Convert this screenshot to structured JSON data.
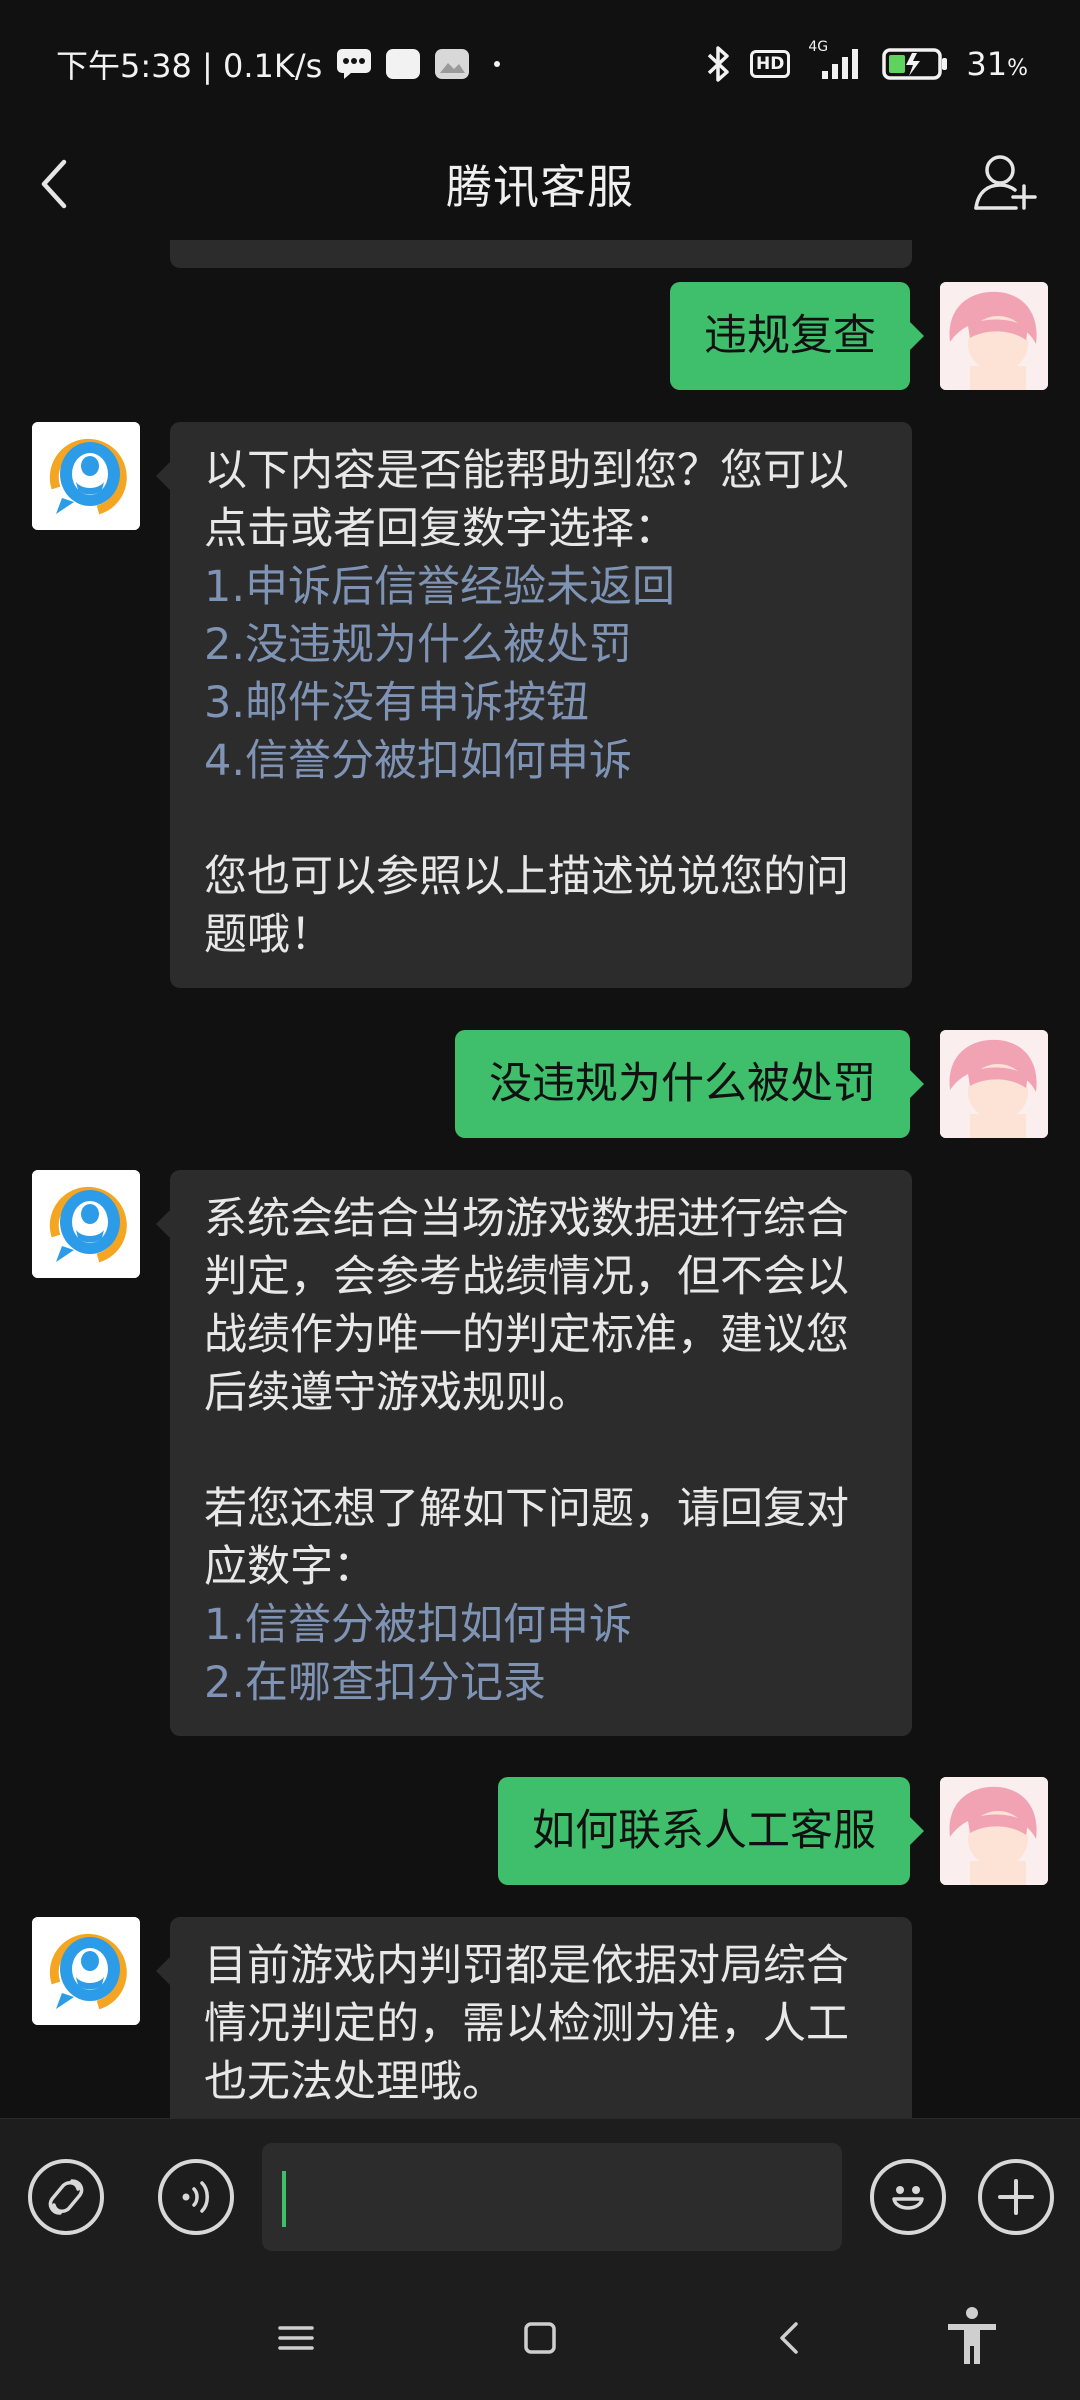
{
  "status_bar": {
    "time_speed": "下午5:38 | 0.1K/s",
    "hd": "HD",
    "network": "4G",
    "battery": "31",
    "battery_unit": "%"
  },
  "header": {
    "title": "腾讯客服"
  },
  "messages": [
    {
      "side": "out",
      "text": "违规复查"
    },
    {
      "side": "in",
      "intro": [
        "以下内容是否能帮助到您？您可以",
        "点击或者回复数字选择："
      ],
      "options": [
        "1.申诉后信誉经验未返回",
        "2.没违规为什么被处罚",
        "3.邮件没有申诉按钮",
        "4.信誉分被扣如何申诉"
      ],
      "outro": [
        "您也可以参照以上描述说说您的问",
        "题哦！"
      ]
    },
    {
      "side": "out",
      "text": "没违规为什么被处罚"
    },
    {
      "side": "in",
      "intro": [
        "系统会结合当场游戏数据进行综合",
        "判定，会参考战绩情况，但不会以",
        "战绩作为唯一的判定标准，建议您",
        "后续遵守游戏规则。"
      ],
      "intro2": [
        "若您还想了解如下问题，请回复对",
        "应数字："
      ],
      "options": [
        "1.信誉分被扣如何申诉",
        "2.在哪查扣分记录"
      ]
    },
    {
      "side": "out",
      "text": "如何联系人工客服"
    },
    {
      "side": "in",
      "intro": [
        "目前游戏内判罚都是依据对局综合",
        "情况判定的，需以检测为准，人工",
        "也无法处理哦。"
      ]
    }
  ],
  "input": {
    "value": ""
  },
  "icons": {
    "back": "back-arrow-icon",
    "add_friend": "add-person-icon",
    "mini_program": "link-icon",
    "voice": "voice-icon",
    "emoji": "emoji-icon",
    "more": "plus-icon"
  },
  "colors": {
    "outgoing_bubble": "#3fbf6c",
    "incoming_bubble": "#2c2c2c",
    "option_link": "#7f93b4"
  }
}
